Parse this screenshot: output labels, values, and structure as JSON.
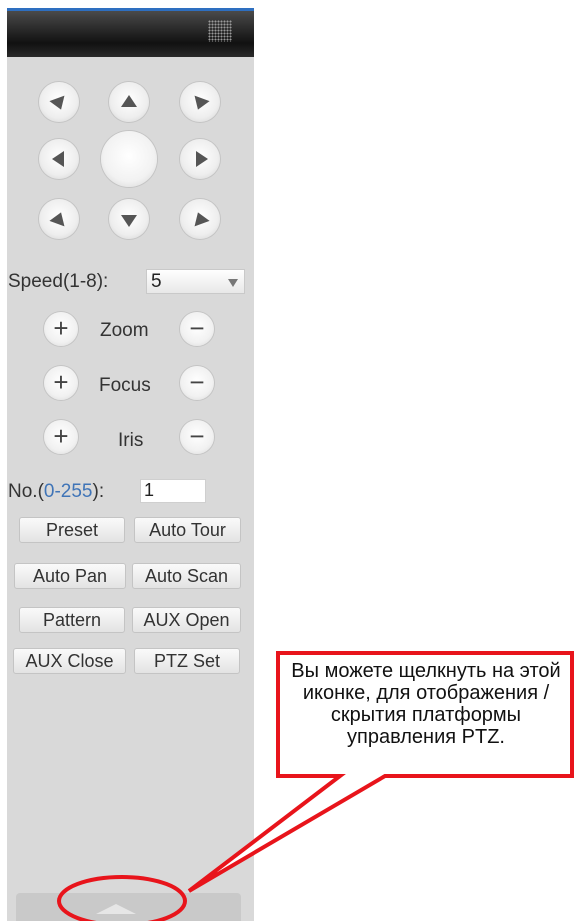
{
  "ptz": {
    "speed_label": "Speed(1-8):",
    "speed_value": "5",
    "zoom_label": "Zoom",
    "focus_label": "Focus",
    "iris_label": "Iris",
    "plus": "+",
    "minus": "−",
    "no_prefix": "No.(",
    "no_range": "0-255",
    "no_suffix": "):",
    "no_value": "1",
    "buttons": {
      "preset": "Preset",
      "auto_tour": "Auto Tour",
      "auto_pan": "Auto Pan",
      "auto_scan": "Auto Scan",
      "pattern": "Pattern",
      "aux_open": "AUX Open",
      "aux_close": "AUX Close",
      "ptz_set": "PTZ Set"
    }
  },
  "callout": {
    "text": "Вы можете щелкнуть на этой иконке, для отображения / скрытия платформы управления PTZ."
  },
  "colors": {
    "annotation_red": "#e8141b",
    "header_dark": "#111111",
    "panel_bg": "#d9d9d9",
    "range_blue": "#3f74b7"
  },
  "icons": [
    "arrow-up-left-icon",
    "arrow-up-icon",
    "arrow-up-right-icon",
    "arrow-left-icon",
    "arrow-right-icon",
    "arrow-down-left-icon",
    "arrow-down-icon",
    "arrow-down-right-icon",
    "plus-icon",
    "minus-icon",
    "chevron-down-icon",
    "grip-icon"
  ]
}
